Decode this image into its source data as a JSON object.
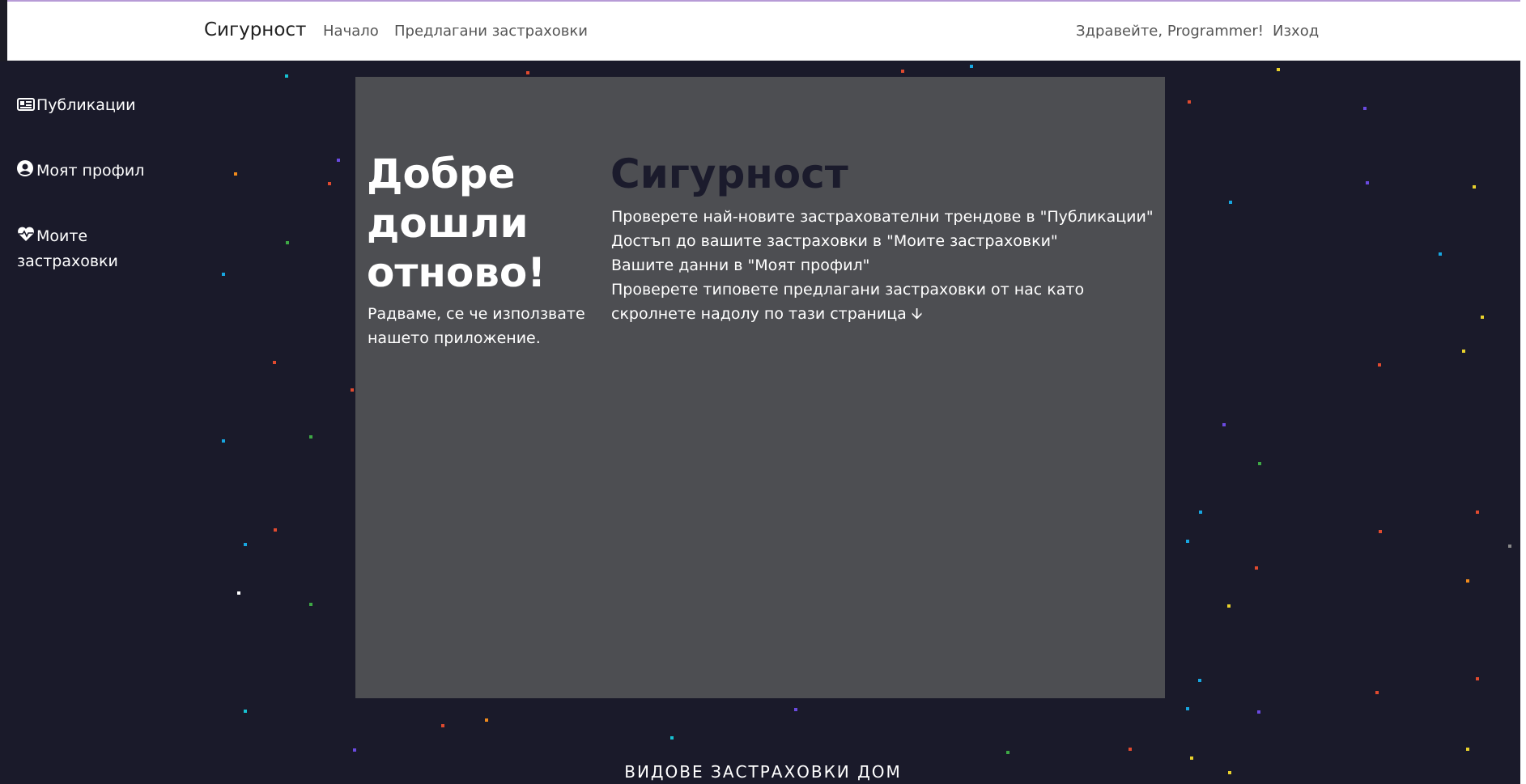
{
  "navbar": {
    "brand": "Сигурност",
    "links": [
      "Начало",
      "Предлагани застраховки"
    ],
    "greeting": "Здравейте, Programmer!",
    "logout": "Изход"
  },
  "sidebar": {
    "items": [
      {
        "label": "Публикации",
        "icon": "newspaper-icon"
      },
      {
        "label": "Моят профил",
        "icon": "user-circle-icon"
      },
      {
        "label": "Моите застраховки",
        "icon": "heart-pulse-icon"
      }
    ]
  },
  "welcome": {
    "title": "Добре дошли отново!",
    "text": "Радваме, се че използвате нашето приложение."
  },
  "brand_panel": {
    "title": "Сигурност",
    "lines": [
      "Проверете най-новите застрахователни трендове в \"Публикации\"",
      "Достъп до вашите застраховки в \"Моите застраховки\"",
      "Вашите данни в \"Моят профил\"",
      "Проверете типовете предлагани застраховки от нас като скролнете надолу по тази страница 🡫"
    ]
  },
  "footer": {
    "heading": "ВИДОВЕ ЗАСТРАХОВКИ ДОМ"
  },
  "colors": {
    "background": "#1a1a2a",
    "panel": "#4d4e52",
    "brand_title": "#1b1b2c",
    "navbar": "#ffffff"
  }
}
